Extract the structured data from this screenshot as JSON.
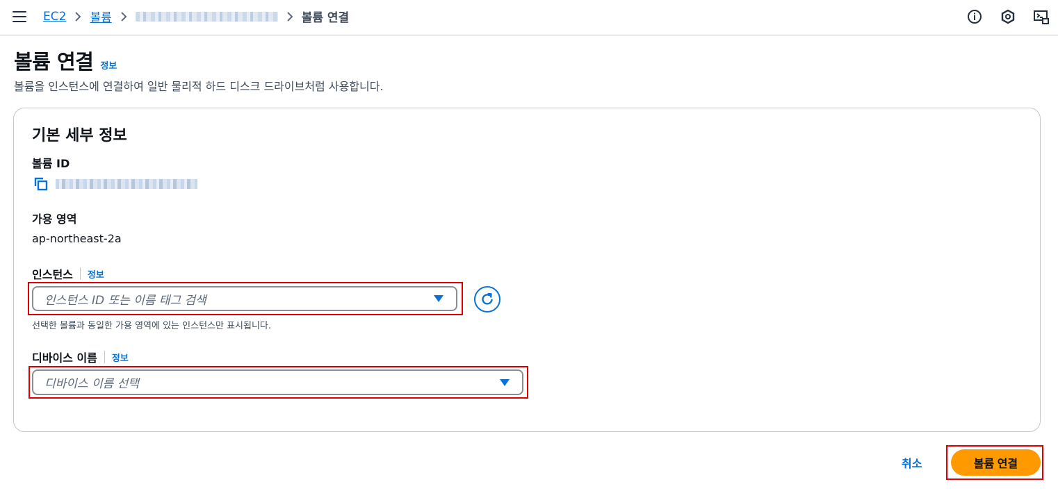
{
  "breadcrumb": {
    "items": [
      {
        "label": "EC2"
      },
      {
        "label": "볼륨"
      }
    ],
    "current": "볼륨 연결"
  },
  "topbar": {
    "icons": [
      "info-icon",
      "notifications-icon",
      "cloudshell-icon"
    ]
  },
  "header": {
    "title": "볼륨 연결",
    "info_link": "정보",
    "description": "볼륨을 인스턴스에 연결하여 일반 물리적 하드 디스크 드라이브처럼 사용합니다."
  },
  "details": {
    "section_title": "기본 세부 정보",
    "volume_id_label": "볼륨 ID",
    "az_label": "가용 영역",
    "az_value": "ap-northeast-2a",
    "instance_label": "인스턴스",
    "instance_info": "정보",
    "instance_placeholder": "인스턴스 ID 또는 이름 태그 검색",
    "instance_hint": "선택한 볼륨과 동일한 가용 영역에 있는 인스턴스만 표시됩니다.",
    "device_label": "디바이스 이름",
    "device_info": "정보",
    "device_placeholder": "디바이스 이름 선택"
  },
  "footer": {
    "cancel_label": "취소",
    "submit_label": "볼륨 연결"
  },
  "colors": {
    "link": "#0972d3",
    "primary": "#ff9900",
    "highlight": "#e00000"
  }
}
